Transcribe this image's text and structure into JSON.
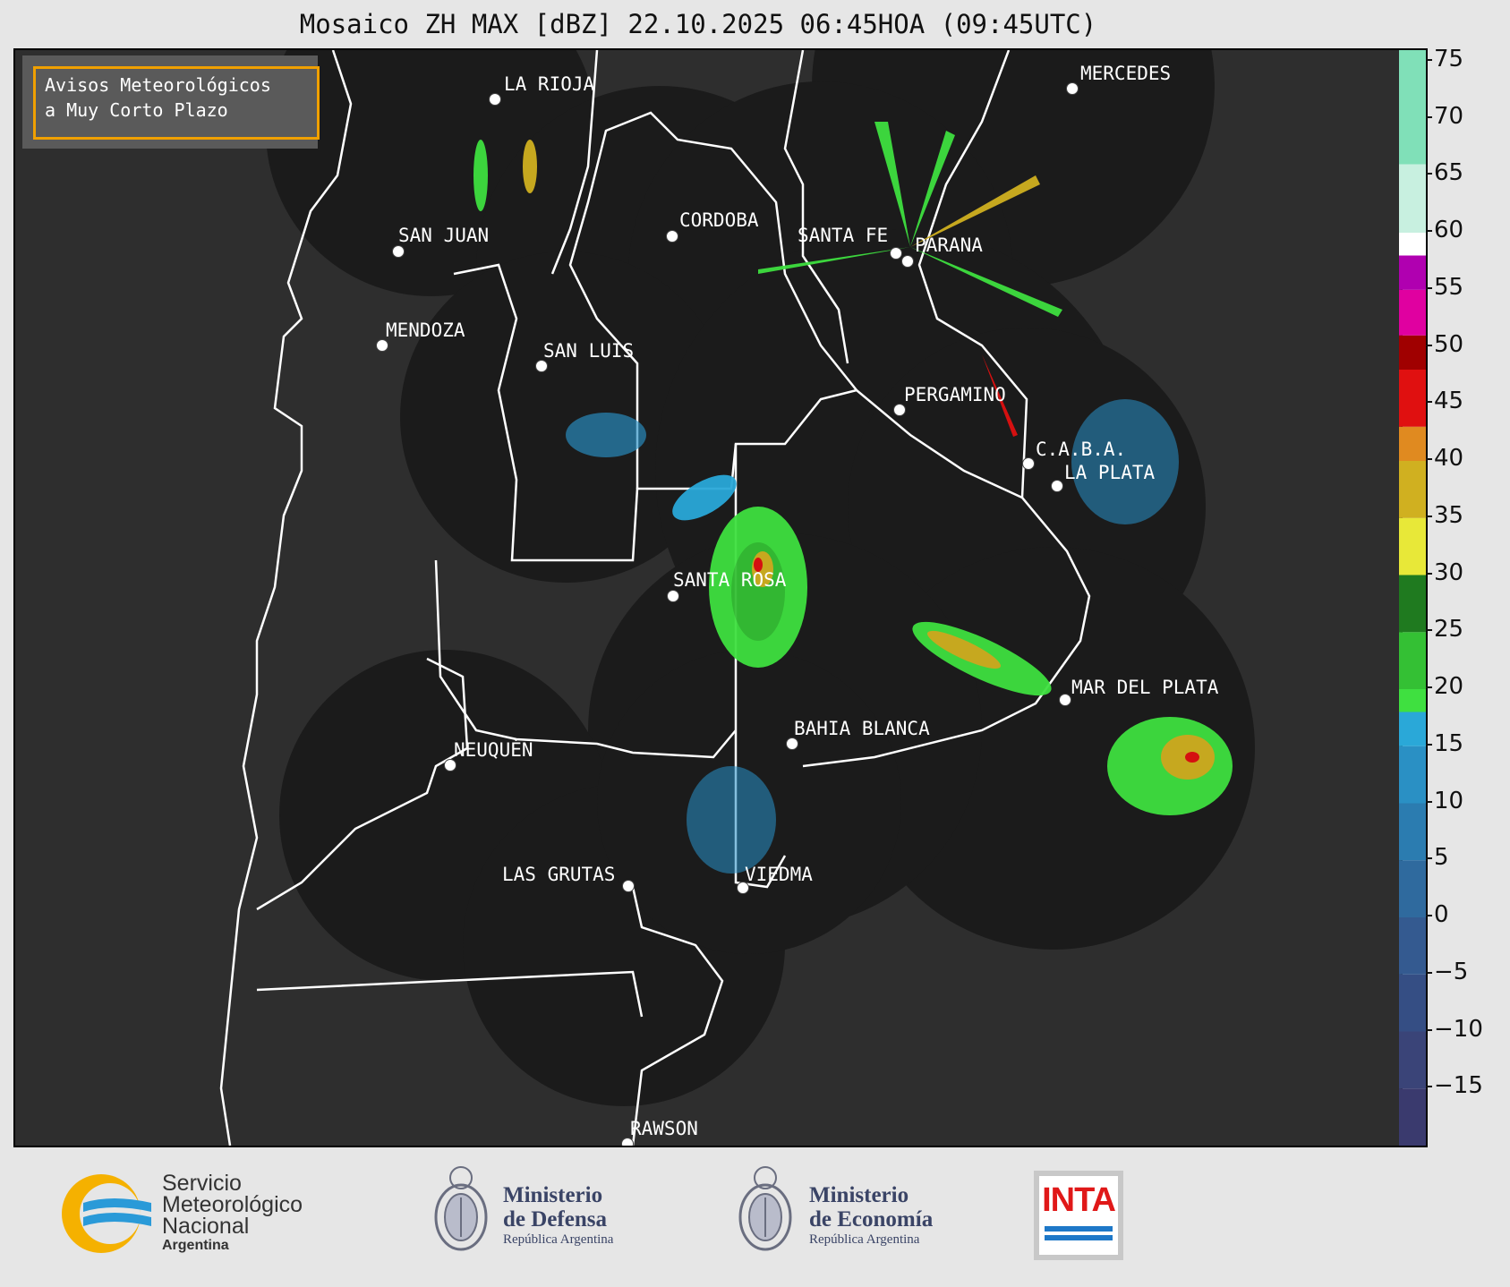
{
  "title": "Mosaico ZH MAX [dBZ] 22.10.2025 06:45HOA (09:45UTC)",
  "warning_box": {
    "line1": "Avisos Meteorológicos",
    "line2": "a Muy Corto Plazo",
    "border_color": "#f0a000"
  },
  "cities": [
    {
      "name": "LA RIOJA"
    },
    {
      "name": "MERCEDES"
    },
    {
      "name": "SAN JUAN"
    },
    {
      "name": "CORDOBA"
    },
    {
      "name": "SANTA FE"
    },
    {
      "name": "PARANA"
    },
    {
      "name": "MENDOZA"
    },
    {
      "name": "SAN LUIS"
    },
    {
      "name": "PERGAMINO"
    },
    {
      "name": "C.A.B.A."
    },
    {
      "name": "LA PLATA"
    },
    {
      "name": "SANTA ROSA"
    },
    {
      "name": "MAR DEL PLATA"
    },
    {
      "name": "BAHIA BLANCA"
    },
    {
      "name": "NEUQUÉN"
    },
    {
      "name": "LAS GRUTAS"
    },
    {
      "name": "VIEDMA"
    },
    {
      "name": "RAWSON"
    }
  ],
  "colorbar": {
    "unit": "dBZ",
    "min": -20,
    "max": 76,
    "ticks": [
      "75",
      "70",
      "65",
      "60",
      "55",
      "50",
      "45",
      "40",
      "35",
      "30",
      "25",
      "20",
      "15",
      "10",
      "5",
      "0",
      "−5",
      "−10",
      "−15"
    ],
    "stops": [
      {
        "from": -20,
        "to": -15,
        "color": "#3a3a6e"
      },
      {
        "from": -15,
        "to": -10,
        "color": "#3a4478"
      },
      {
        "from": -10,
        "to": -5,
        "color": "#354e84"
      },
      {
        "from": -5,
        "to": 0,
        "color": "#345a90"
      },
      {
        "from": 0,
        "to": 5,
        "color": "#2f6a9e"
      },
      {
        "from": 5,
        "to": 10,
        "color": "#2b7cb0"
      },
      {
        "from": 10,
        "to": 15,
        "color": "#2a90c4"
      },
      {
        "from": 15,
        "to": 18,
        "color": "#2aa8d8"
      },
      {
        "from": 18,
        "to": 20,
        "color": "#3fe040"
      },
      {
        "from": 20,
        "to": 25,
        "color": "#34c034"
      },
      {
        "from": 25,
        "to": 30,
        "color": "#1f7a1f"
      },
      {
        "from": 30,
        "to": 35,
        "color": "#e8e838"
      },
      {
        "from": 35,
        "to": 40,
        "color": "#d0b020"
      },
      {
        "from": 40,
        "to": 43,
        "color": "#e08a20"
      },
      {
        "from": 43,
        "to": 48,
        "color": "#e01010"
      },
      {
        "from": 48,
        "to": 51,
        "color": "#a00000"
      },
      {
        "from": 51,
        "to": 55,
        "color": "#e000a0"
      },
      {
        "from": 55,
        "to": 58,
        "color": "#b000b0"
      },
      {
        "from": 58,
        "to": 60,
        "color": "#ffffff"
      },
      {
        "from": 60,
        "to": 66,
        "color": "#c8f0e0"
      },
      {
        "from": 66,
        "to": 76,
        "color": "#80e0b8"
      }
    ]
  },
  "logos": {
    "smn_line1": "Servicio",
    "smn_line2": "Meteorológico",
    "smn_line3": "Nacional",
    "smn_line4": "Argentina",
    "defensa_line1": "Ministerio",
    "defensa_line2": "de Defensa",
    "defensa_line3": "República Argentina",
    "economia_line1": "Ministerio",
    "economia_line2": "de Economía",
    "economia_line3": "República Argentina",
    "inta": "INTA"
  }
}
